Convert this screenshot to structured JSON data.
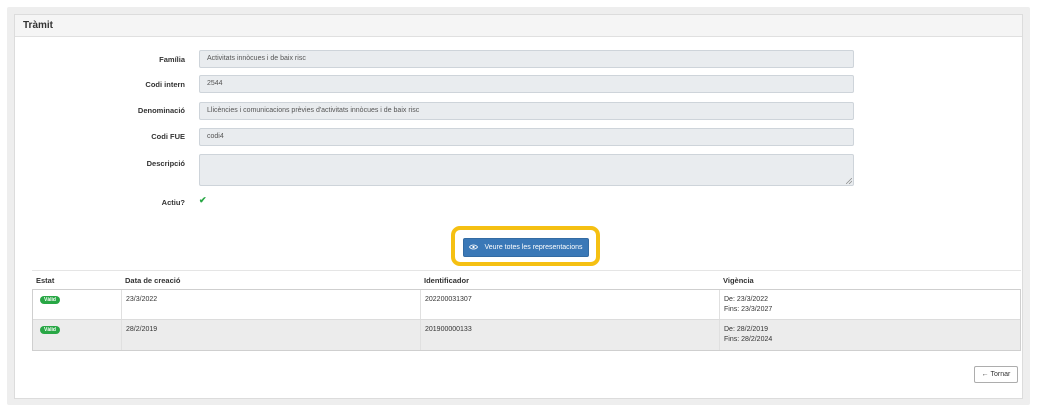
{
  "panel": {
    "title": "Tràmit"
  },
  "form": {
    "familia_label": "Família",
    "familia_value": "Activitats innòcues i de baix risc",
    "codi_intern_label": "Codi intern",
    "codi_intern_value": "2544",
    "denominacio_label": "Denominació",
    "denominacio_value": "Llicències i comunicacions prèvies d'activitats innòcues i de baix risc",
    "codi_fue_label": "Codi FUE",
    "codi_fue_value": "codi4",
    "descripcio_label": "Descripció",
    "descripcio_value": "",
    "actiu_label": "Actiu?",
    "actiu_value": "✔"
  },
  "actions": {
    "view_all_label": "Veure totes les representacions",
    "back_label": "Tornar",
    "view_icon": "eye-icon",
    "back_icon": "arrow-left-icon"
  },
  "table": {
    "headers": [
      "Estat",
      "Data de creació",
      "Identificador",
      "Vigència"
    ],
    "rows": [
      {
        "estat": "Vàlid",
        "data": "23/3/2022",
        "identificador": "202200031307",
        "vigencia_de": "De: 23/3/2022",
        "vigencia_fins": "Fins: 23/3/2027"
      },
      {
        "estat": "Vàlid",
        "data": "28/2/2019",
        "identificador": "201900000133",
        "vigencia_de": "De: 28/2/2019",
        "vigencia_fins": "Fins: 28/2/2024"
      }
    ]
  },
  "colors": {
    "accent": "#3a78b7",
    "highlight": "#f5c012",
    "success": "#28a745"
  }
}
